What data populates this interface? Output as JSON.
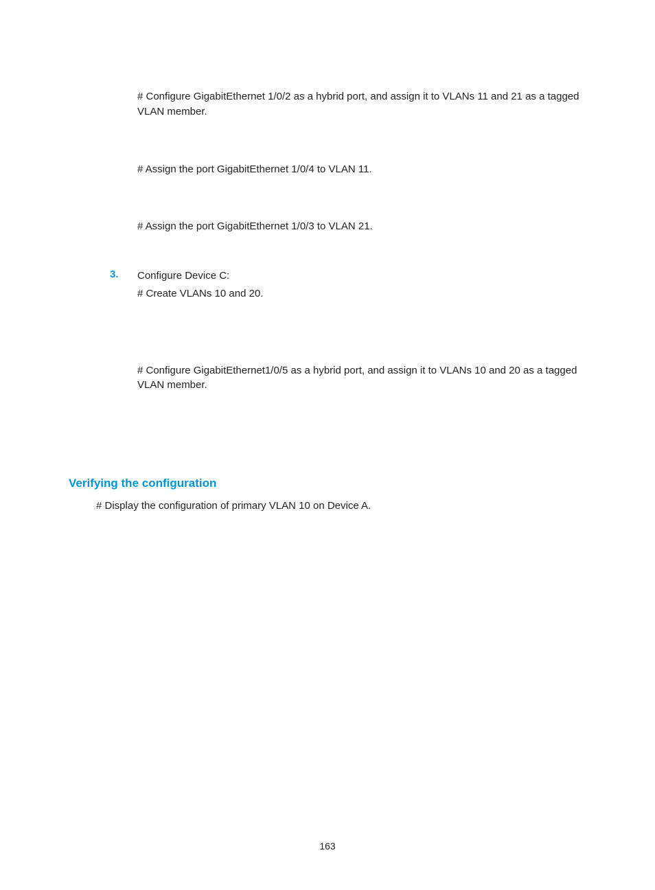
{
  "p1": "# Configure GigabitEthernet 1/0/2 as a hybrid port, and assign it to VLANs 11 and 21 as a tagged VLAN member.",
  "p2": "# Assign the port GigabitEthernet 1/0/4 to VLAN 11.",
  "p3": "# Assign the port GigabitEthernet 1/0/3 to VLAN 21.",
  "step": {
    "num": "3.",
    "title": "Configure Device C:",
    "sub": "# Create VLANs 10 and 20."
  },
  "p4": "# Configure GigabitEthernet1/0/5 as a hybrid port, and assign it to VLANs 10 and 20 as a tagged VLAN member.",
  "heading": "Verifying the configuration",
  "p5": "# Display the configuration of primary VLAN 10 on Device A.",
  "page_number": "163"
}
